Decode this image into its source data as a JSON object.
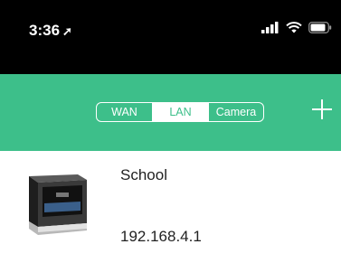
{
  "status": {
    "time": "3:36",
    "location_icon": "location-arrow-icon",
    "signal_icon": "cellular-signal-icon",
    "wifi_icon": "wifi-icon",
    "battery_icon": "battery-icon"
  },
  "nav": {
    "tabs": [
      {
        "label": "WAN",
        "active": false
      },
      {
        "label": "LAN",
        "active": true
      },
      {
        "label": "Camera",
        "active": false
      }
    ],
    "add_icon": "plus-icon",
    "accent": "#3dbf8a"
  },
  "devices": [
    {
      "name": "School",
      "ip": "192.168.4.1",
      "icon": "3d-printer-icon"
    }
  ]
}
